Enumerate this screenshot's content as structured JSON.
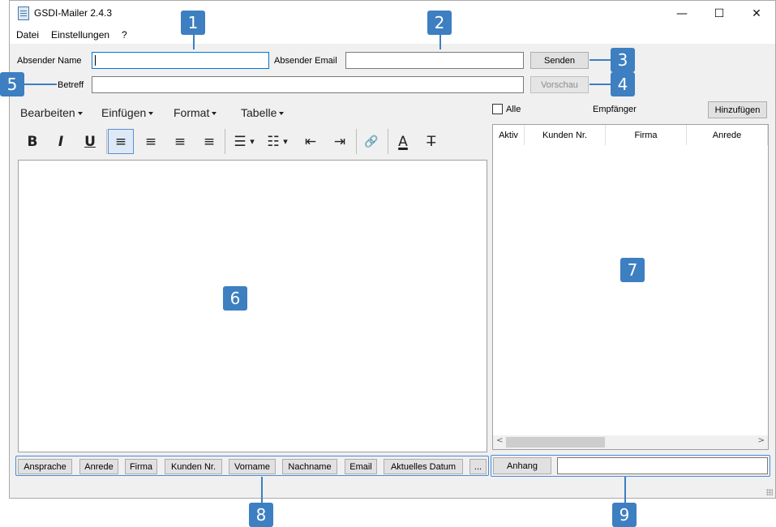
{
  "window": {
    "title": "GSDI-Mailer 2.4.3",
    "controls": {
      "minimize": "—",
      "maximize": "☐",
      "close": "✕"
    }
  },
  "menu": [
    "Datei",
    "Einstellungen",
    "?"
  ],
  "form": {
    "sender_name_label": "Absender Name",
    "sender_name_value": "",
    "sender_email_label": "Absender Email",
    "sender_email_value": "",
    "subject_label": "Betreff",
    "subject_value": "",
    "send_button": "Senden",
    "preview_button": "Vorschau"
  },
  "editor": {
    "menus": [
      "Bearbeiten",
      "Einfügen",
      "Format",
      "Tabelle"
    ],
    "toolbar": [
      "bold",
      "italic",
      "underline",
      "align-left",
      "align-center",
      "align-right",
      "justify",
      "bullet-list",
      "numbered-list",
      "outdent",
      "indent",
      "link",
      "text-color",
      "clear-format"
    ],
    "toolbar_glyphs": {
      "bold": "B",
      "italic": "I",
      "underline": "U",
      "align_left": "≡",
      "align_center": "≡",
      "align_right": "≡",
      "justify": "≡",
      "bullet_list": "☰",
      "numbered_list": "☷",
      "outdent": "⇤",
      "indent": "⇥",
      "link": "🔗",
      "text_color": "A",
      "clear_format": "T̶",
      "dropdown": "▾"
    },
    "active_tool": "align-left",
    "content": ""
  },
  "recipients": {
    "select_all_label": "Alle",
    "heading": "Empfänger",
    "add_button": "Hinzufügen",
    "columns": [
      "Aktiv",
      "Kunden Nr.",
      "Firma",
      "Anrede"
    ],
    "rows": [],
    "scroll_left": "<",
    "scroll_right": ">"
  },
  "placeholders": [
    "Ansprache",
    "Anrede",
    "Firma",
    "Kunden Nr.",
    "Vorname",
    "Nachname",
    "Email",
    "Aktuelles Datum",
    "..."
  ],
  "attachment": {
    "button": "Anhang",
    "value": ""
  },
  "callouts": [
    "1",
    "2",
    "3",
    "4",
    "5",
    "6",
    "7",
    "8",
    "9"
  ],
  "colors": {
    "callout": "#3d7fc1",
    "focus_border": "#0078d7",
    "window_bg": "#f0f0f0"
  }
}
